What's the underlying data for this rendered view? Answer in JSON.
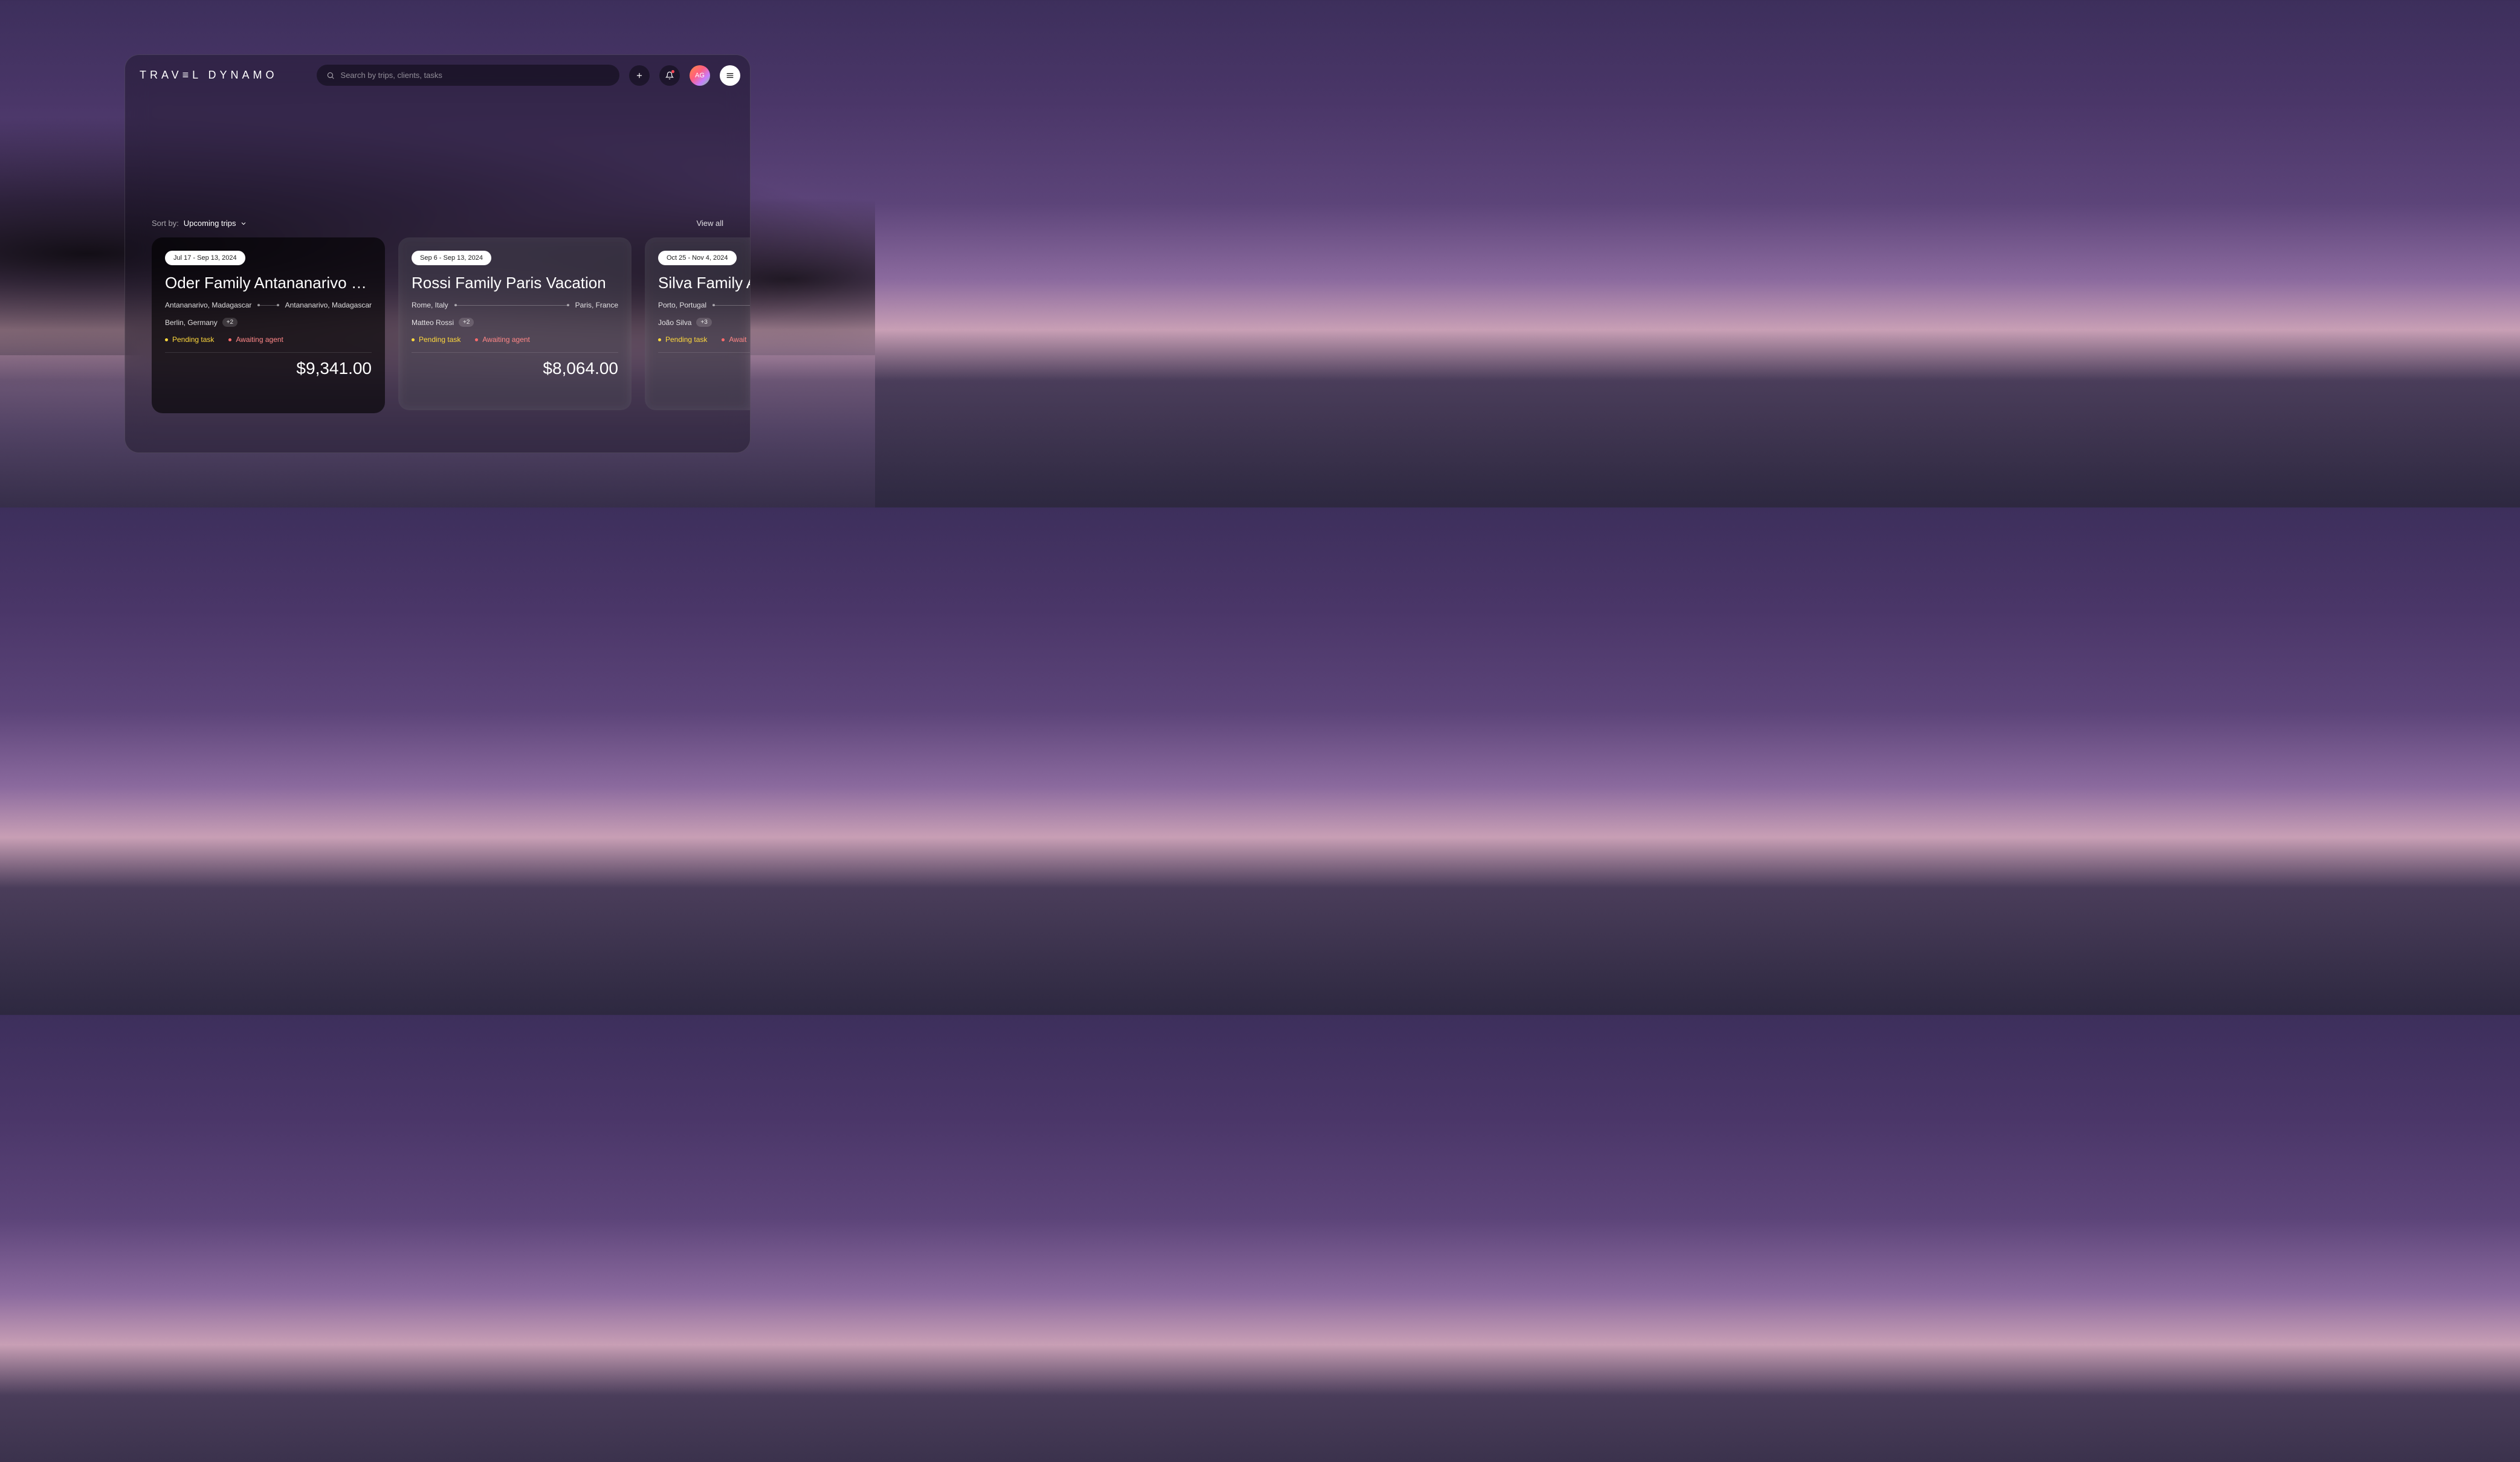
{
  "logo": "TRAV≡L DYNAMO",
  "search": {
    "placeholder": "Search by trips, clients, tasks"
  },
  "avatar": {
    "initials": "AG"
  },
  "toolbar": {
    "sort_label": "Sort by:",
    "sort_value": "Upcoming trips",
    "view_all": "View all"
  },
  "cards": [
    {
      "date_range": "Jul 17 - Sep 13, 2024",
      "title": "Oder Family Antananarivo Vac..",
      "origin": "Antananarivo, Madagascar",
      "destination": "Antananarivo, Madagascar",
      "client": "Berlin, Germany",
      "extra": "+2",
      "status_pending": "Pending task",
      "status_awaiting": "Awaiting agent",
      "price": "$9,341.00"
    },
    {
      "date_range": "Sep 6 - Sep 13, 2024",
      "title": "Rossi Family Paris Vacation",
      "origin": "Rome, Italy",
      "destination": "Paris, France",
      "client": "Matteo Rossi",
      "extra": "+2",
      "status_pending": "Pending task",
      "status_awaiting": "Awaiting agent",
      "price": "$8,064.00"
    },
    {
      "date_range": "Oct 25 - Nov 4, 2024",
      "title": "Silva Family A",
      "origin": "Porto, Portugal",
      "destination": "",
      "client": "João Silva",
      "extra": "+3",
      "status_pending": "Pending task",
      "status_awaiting": "Await",
      "price": ""
    }
  ]
}
